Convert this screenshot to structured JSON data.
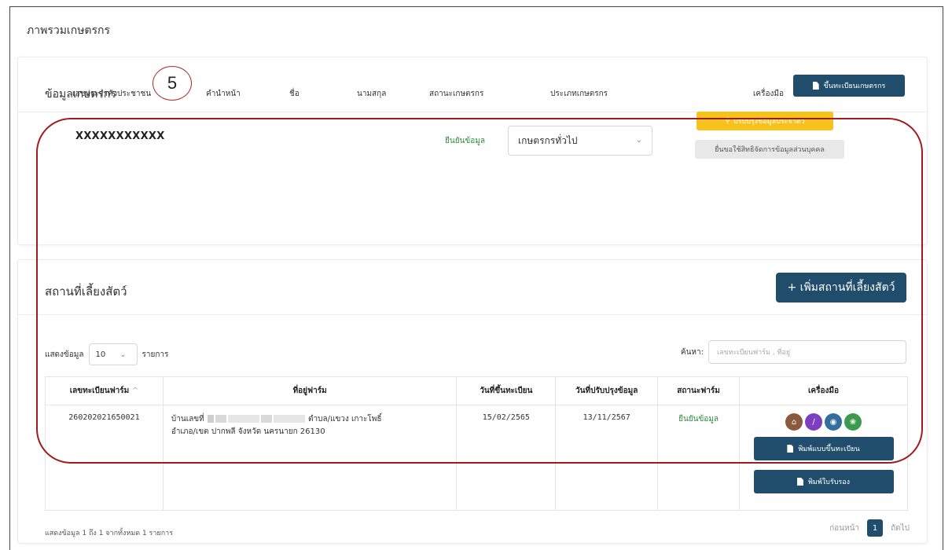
{
  "page": {
    "title": "ภาพรวมเกษตรกร"
  },
  "farmer": {
    "section_title": "ข้อมูลเกษตรกร",
    "register_button": "ขึ้นทะเบียนเกษตรกร",
    "headers": {
      "id": "เลขประจำตัวประชาชน",
      "prefix": "คำนำหน้า",
      "first_name": "ชื่อ",
      "last_name": "นามสกุล",
      "status": "สถานะเกษตรกร",
      "type": "ประเภทเกษตรกร",
      "tools": "เครื่องมือ"
    },
    "id_value": "XXXXXXXXXXX",
    "status_value": "ยืนยันข้อมูล",
    "type_value": "เกษตรกรทั่วไป",
    "update_button": "ปรับปรุงข้อมูลประจำตัว",
    "rights_button": "ยื่นขอใช้สิทธิจัดการข้อมูลส่วนบุคคล"
  },
  "annotation": {
    "number": "5"
  },
  "livestock": {
    "section_title": "สถานที่เลี้ยงสัตว์",
    "add_button": "+ เพิ่มสถานที่เลี้ยงสัตว์",
    "show_label": "แสดงข้อมูล",
    "show_value": "10",
    "show_suffix": "รายการ",
    "search_label": "ค้นหา:",
    "search_placeholder": "เลขทะเบียนฟาร์ม , ที่อยู่",
    "table": {
      "headers": [
        "เลขทะเบียนฟาร์ม",
        "ที่อยู่ฟาร์ม",
        "วันที่ขึ้นทะเบียน",
        "วันที่ปรับปรุงข้อมูล",
        "สถานะฟาร์ม",
        "เครื่องมือ"
      ],
      "row": {
        "farm_id": "260202021650021",
        "address_prefix": "บ้านเลขที่",
        "address_mid": "ตำบล/แขวง เกาะโพธิ์",
        "address_line2": "อำเภอ/เขต ปากพลี จังหวัด นครนายก 26130",
        "registered": "15/02/2565",
        "updated": "13/11/2567",
        "status": "ยืนยันข้อมูล"
      }
    },
    "print_register_button": "พิมพ์แบบขึ้นทะเบียน",
    "print_cert_button": "พิมพ์ใบรับรอง",
    "footer_info": "แสดงข้อมูล 1 ถึง 1 จากทั้งหมด 1 รายการ",
    "pager": {
      "prev": "ก่อนหน้า",
      "current": "1",
      "next": "ถัดไป"
    }
  },
  "colors": {
    "primary": "#1f4d6b",
    "yellow": "#f6c21e",
    "green": "#2e8b3a",
    "annotation": "#a01b1f"
  }
}
